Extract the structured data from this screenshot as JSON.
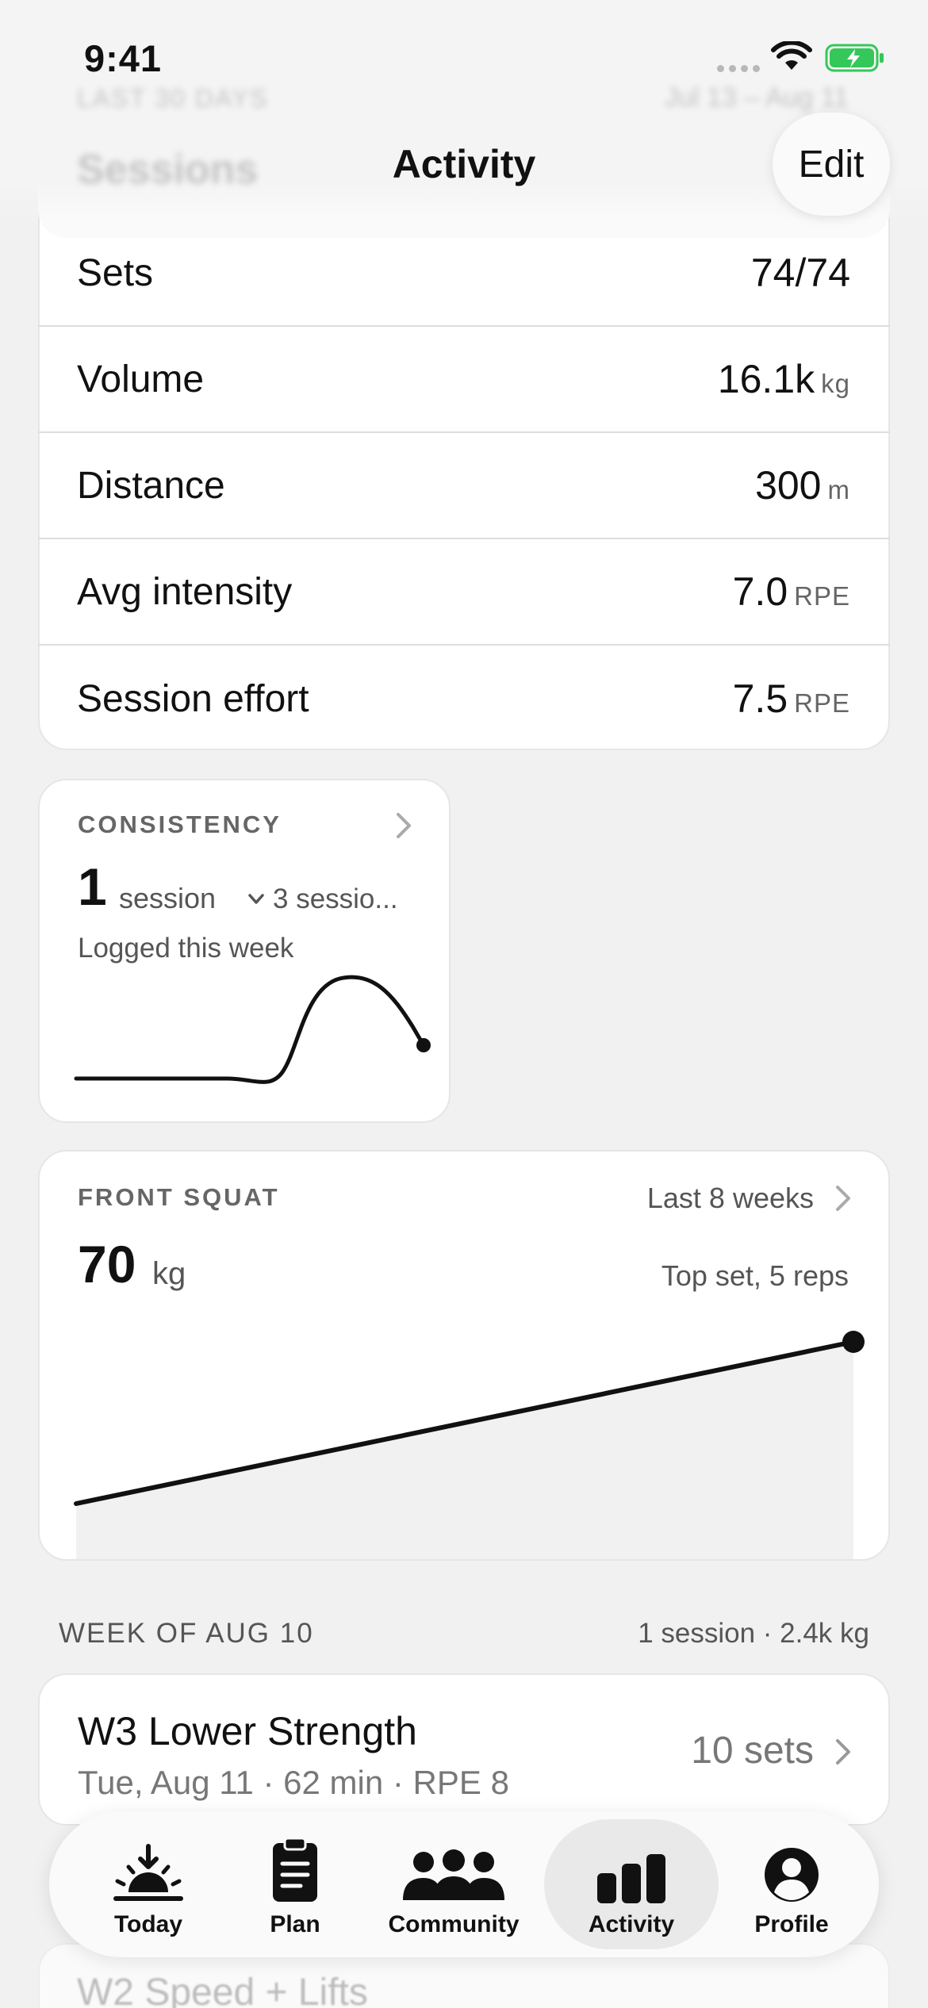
{
  "status": {
    "time": "9:41"
  },
  "header": {
    "title": "Activity",
    "edit_label": "Edit",
    "ghost_label": "LAST 30 DAYS",
    "ghost_range": "Jul 13 – Aug 11",
    "ghost_title": "Sessions"
  },
  "stats": [
    {
      "label": "Sets",
      "value": "74/74",
      "unit": ""
    },
    {
      "label": "Volume",
      "value": "16.1k",
      "unit": "kg"
    },
    {
      "label": "Distance",
      "value": "300",
      "unit": "m"
    },
    {
      "label": "Avg intensity",
      "value": "7.0",
      "unit": "RPE"
    },
    {
      "label": "Session effort",
      "value": "7.5",
      "unit": "RPE"
    }
  ],
  "consistency": {
    "label": "CONSISTENCY",
    "count": "1",
    "count_unit": "session",
    "goal": "3 sessio...",
    "subtitle": "Logged this week"
  },
  "front_squat": {
    "label": "FRONT SQUAT",
    "range": "Last 8 weeks",
    "value": "70",
    "unit": "kg",
    "note": "Top set, 5 reps"
  },
  "week": {
    "header": "WEEK OF AUG 10",
    "summary": "1 session · 2.4k kg",
    "session": {
      "title": "W3 Lower Strength",
      "meta": "Tue, Aug 11 · 62 min · RPE 8",
      "sets": "10 sets"
    },
    "next_session_title": "W2 Speed + Lifts"
  },
  "tabs": [
    {
      "label": "Today",
      "icon": "sunrise-icon"
    },
    {
      "label": "Plan",
      "icon": "clipboard-icon"
    },
    {
      "label": "Community",
      "icon": "people-icon"
    },
    {
      "label": "Activity",
      "icon": "bar-chart-icon",
      "active": true
    },
    {
      "label": "Profile",
      "icon": "person-circle-icon"
    }
  ],
  "colors": {
    "background": "#f1f1f1",
    "card": "#ffffff",
    "battery_green": "#34c759",
    "text_primary": "#111111",
    "text_secondary": "#666666"
  }
}
